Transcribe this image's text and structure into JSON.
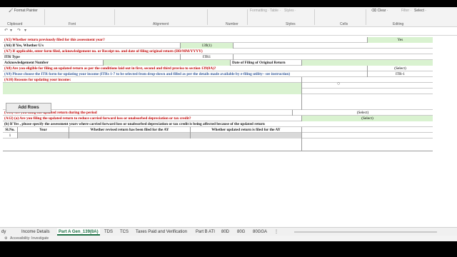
{
  "ribbon": {
    "format_painter": "Format Painter",
    "formatting": "Formatting ·",
    "table": "Table ·",
    "styles_drop": "Styles ·",
    "clear": "Clear ·",
    "filter": "Filter ·",
    "select": "Select ·",
    "groups": [
      "Clipboard",
      "Font",
      "Alignment",
      "Number",
      "Styles",
      "Cells",
      "Editing"
    ]
  },
  "rows": {
    "a5_label": "(A5) Whether return previously filed for this assessment year?",
    "a5_value": "Yes",
    "a6_label": "(A6) If Yes, Whether U/s",
    "a6_value": "139(1)",
    "a7_label": "(A7) If applicable, enter form filed, acknowledgement no. or Receipt no. and date of filing original return (DD/MM/YYYY)",
    "itr_type_label": "ITR Type",
    "itr_type_value": "ITR1",
    "ack_label": "Acknowledgement Number",
    "date_label": "Date of Filing of Original Return",
    "a8_label": "(A8) Are you eligible for filing an updated return as per the conditions laid out in first, second and third proviso to section 139(8A)?",
    "a8_value": "(Select)",
    "a9_label": "(A9) Please choose the ITR form for updating your income (ITRs 1-7 to be selected from drop-down and filled as per the details made available by e-filing utility– see instruction)",
    "a9_value": "ITR-1",
    "a10_label": "(A10) Reasons for updating your income:",
    "add_rows": "Add Rows",
    "a11_label": "(A11) Are you filing the updated return during the period",
    "a11_value": "(Select)",
    "a12_label": "(A12) (a) Are you filing the updated return to reduce carried forward loss or unabsorbed depreciation or tax credit?",
    "a12_value": "(Select)",
    "b_label": "(b) If Yes , please specify the assessment years where carried forward loss or unabsorbed depreciation or tax credit is being affected because of the updated return",
    "headers": [
      "Sl.No.",
      "Year",
      "Whether revised return has been filed for the AY",
      "Whether updated return is filed for the AY"
    ],
    "first_row_no": "1"
  },
  "tabs": [
    "dy",
    "Income Details",
    "Part A Gen_139(8A)",
    "TDS",
    "TCS",
    "Taxes Paid and Verification",
    "Part B ATI",
    "80D",
    "80G",
    "80GGA"
  ],
  "status": {
    "accessibility": "Accessibility: Investigate"
  }
}
